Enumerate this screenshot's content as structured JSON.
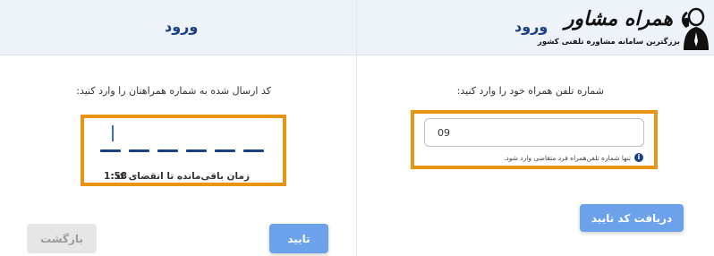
{
  "verify_panel": {
    "title": "ورود",
    "prompt": "کد ارسال شده به شماره همراهتان را وارد کنید:",
    "code_slots": 6,
    "timer_label": "زمان باقی‌مانده تا انقضای کد:",
    "timer_value": "1:58",
    "confirm_button": "تایید",
    "back_button": "بازگشت"
  },
  "login_panel": {
    "title": "ورود",
    "prompt": "شماره تلفن همراه خود را وارد کنید:",
    "phone_value": "09",
    "hint_icon": "info-icon",
    "hint_text": "تنها شماره تلفن‌همراه فرد متقاضی وارد شود.",
    "send_button": "دریافت کد تایید"
  },
  "logo": {
    "name": "همراه مشاور",
    "tagline": "بزرگترین سامانه مشاوره تلفنی کشور"
  },
  "colors": {
    "brand_blue": "#1b3f87",
    "button_blue": "#6ca1ec",
    "highlight_orange": "#e79512",
    "header_bg": "#eef2f9"
  }
}
